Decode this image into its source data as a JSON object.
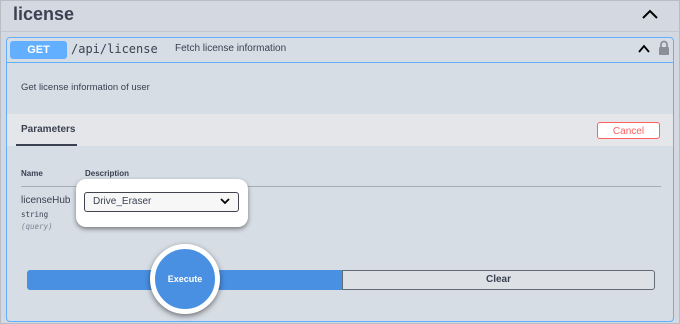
{
  "section": {
    "title": "license",
    "toggle_icon": "chevron-up-icon"
  },
  "operation": {
    "method": "GET",
    "path": "/api/license",
    "summary": "Fetch license information",
    "description": "Get license information of user",
    "method_color": "#61affe",
    "collapse_icon": "chevron-up-icon",
    "lock_icon": "lock-icon"
  },
  "parameters": {
    "tab_label": "Parameters",
    "cancel_label": "Cancel",
    "columns": {
      "name": "Name",
      "description": "Description"
    },
    "items": [
      {
        "name": "licenseHub",
        "type": "string",
        "in": "(query)",
        "selected_value": "Drive_Eraser"
      }
    ]
  },
  "actions": {
    "execute_label": "Execute",
    "clear_label": "Clear",
    "execute_color": "#4990e2",
    "cancel_color": "#ff6060"
  }
}
